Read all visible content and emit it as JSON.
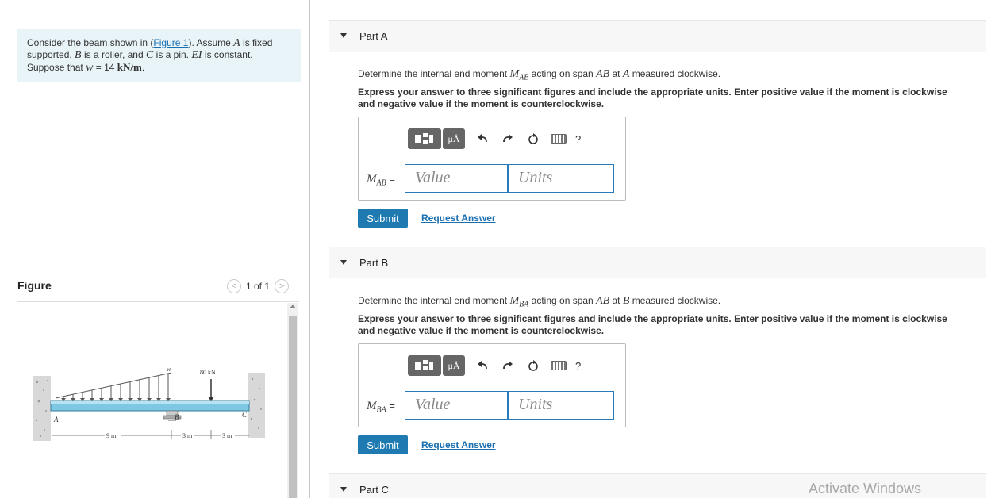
{
  "problem": {
    "intro": "Consider the beam shown in (",
    "figure_link": "Figure 1",
    "after_link": "). Assume ",
    "pointA": "A",
    "fixed_text": " is fixed supported, ",
    "pointB": "B",
    "roller_text": " is a roller, and ",
    "pointC": "C",
    "pin_text": " is a pin. ",
    "EI": "EI",
    "constant_text": " is constant. Suppose that ",
    "w_sym": "w",
    "w_eq": " = 14 ",
    "w_unit": "kN/m",
    "period": "."
  },
  "figure": {
    "title": "Figure",
    "pager": "1 of 1",
    "prev": "<",
    "next": ">",
    "labels": {
      "w": "w",
      "load": "80 kN",
      "A": "A",
      "B": "B",
      "C": "C",
      "d1": "9 m",
      "d2": "3 m",
      "d3": "3 m"
    }
  },
  "parts": [
    {
      "label": "Part A",
      "q_pre": "Determine the internal end moment ",
      "q_sym": "M",
      "q_sub": "AB",
      "q_mid": " acting on span ",
      "q_span": "AB",
      "q_at": " at ",
      "q_pt": "A",
      "q_post": " measured clockwise.",
      "instr": "Express your answer to three significant figures and include the appropriate units. Enter positive value if the moment is clockwise and negative value if the moment is counterclockwise.",
      "var": "M",
      "var_sub": "AB",
      "eq": " =",
      "value_placeholder": "Value",
      "units_placeholder": "Units",
      "submit": "Submit",
      "request": "Request Answer"
    },
    {
      "label": "Part B",
      "q_pre": "Determine the internal end moment ",
      "q_sym": "M",
      "q_sub": "BA",
      "q_mid": " acting on span ",
      "q_span": "AB",
      "q_at": " at ",
      "q_pt": "B",
      "q_post": " measured clockwise.",
      "instr": "Express your answer to three significant figures and include the appropriate units. Enter positive value if the moment is clockwise and negative value if the moment is counterclockwise.",
      "var": "M",
      "var_sub": "BA",
      "eq": " =",
      "value_placeholder": "Value",
      "units_placeholder": "Units",
      "submit": "Submit",
      "request": "Request Answer"
    },
    {
      "label": "Part C"
    }
  ],
  "toolbar": {
    "mu": "μÅ",
    "help": "?"
  },
  "watermark": "Activate Windows"
}
